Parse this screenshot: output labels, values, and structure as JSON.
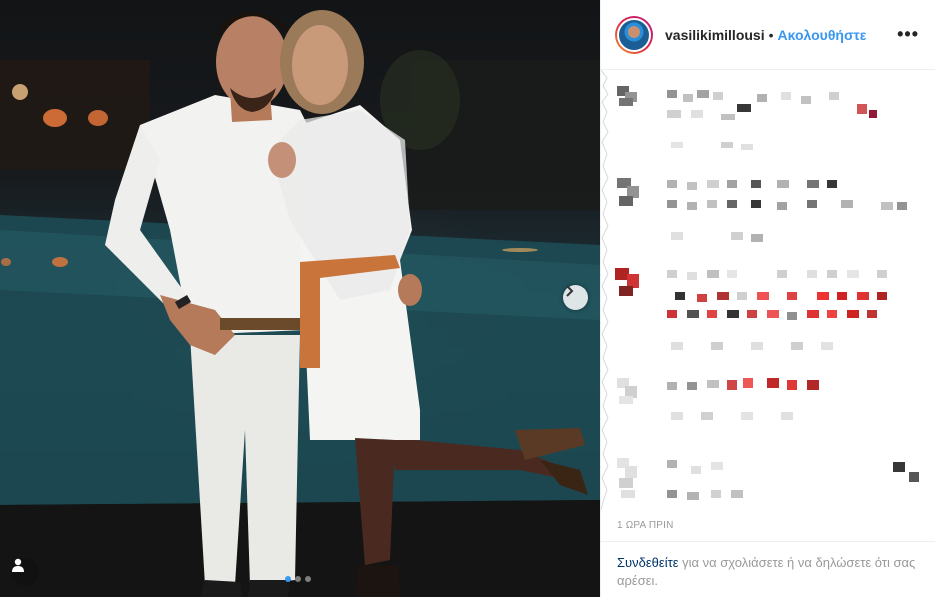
{
  "post": {
    "username": "vasilikimillousi",
    "separator": "•",
    "follow_label": "Ακολουθήστε",
    "more_icon": "•••",
    "timestamp": "1 ΩΡΑ ΠΡΙΝ",
    "login_link": "Συνδεθείτε",
    "login_prompt": " για να σχολιάσετε ή να δηλώσετε ότι σας αρέσει."
  },
  "carousel": {
    "slide_count": 3,
    "active_slide": 1
  },
  "colors": {
    "accent": "#3897f0",
    "link_dark": "#003569",
    "muted": "#999999"
  },
  "icons": {
    "next": "chevron-right-icon",
    "user_tag": "person-icon",
    "more": "more-options-icon"
  }
}
